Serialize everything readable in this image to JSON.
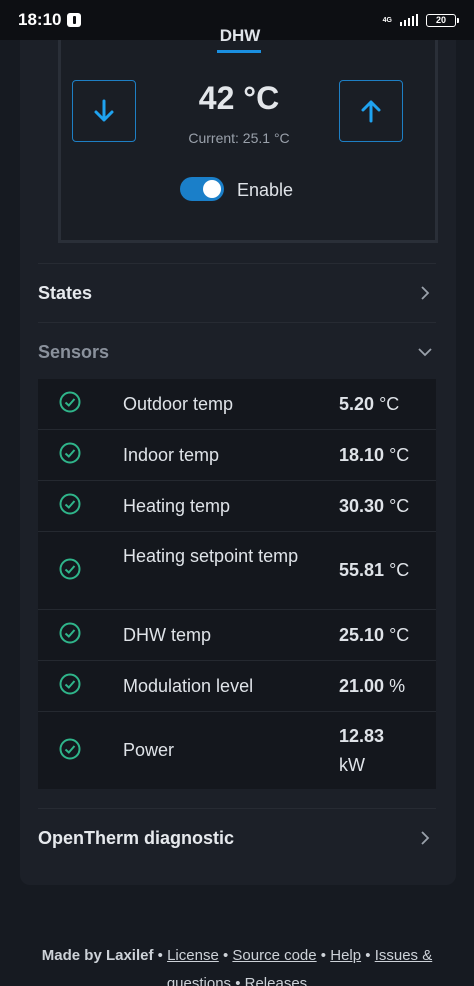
{
  "status_bar": {
    "time": "18:10",
    "network": "4G",
    "battery": "20"
  },
  "thermostat": {
    "tab_label": "DHW",
    "target_temp": "42 °C",
    "current_temp": "Current: 25.1 °C",
    "enable_label": "Enable",
    "enabled": true,
    "accent_color": "#1a8fe0"
  },
  "sections": {
    "states": "States",
    "sensors": "Sensors",
    "diagnostic": "OpenTherm diagnostic"
  },
  "sensors": [
    {
      "name": "Outdoor temp",
      "value": "5.20",
      "unit": "°C",
      "status": "ok"
    },
    {
      "name": "Indoor temp",
      "value": "18.10",
      "unit": "°C",
      "status": "ok"
    },
    {
      "name": "Heating temp",
      "value": "30.30",
      "unit": "°C",
      "status": "ok"
    },
    {
      "name": "Heating setpoint temp",
      "value": "55.81",
      "unit": "°C",
      "status": "ok"
    },
    {
      "name": "DHW temp",
      "value": "25.10",
      "unit": "°C",
      "status": "ok"
    },
    {
      "name": "Modulation level",
      "value": "21.00",
      "unit": "%",
      "status": "ok"
    },
    {
      "name": "Power",
      "value": "12.83",
      "unit": "kW",
      "status": "ok"
    }
  ],
  "footer": {
    "made_by": "Made by Laxilef",
    "sep": "•",
    "links": [
      "License",
      "Source code",
      "Help",
      "Issues &"
    ],
    "second_line": "questions • Releases"
  }
}
